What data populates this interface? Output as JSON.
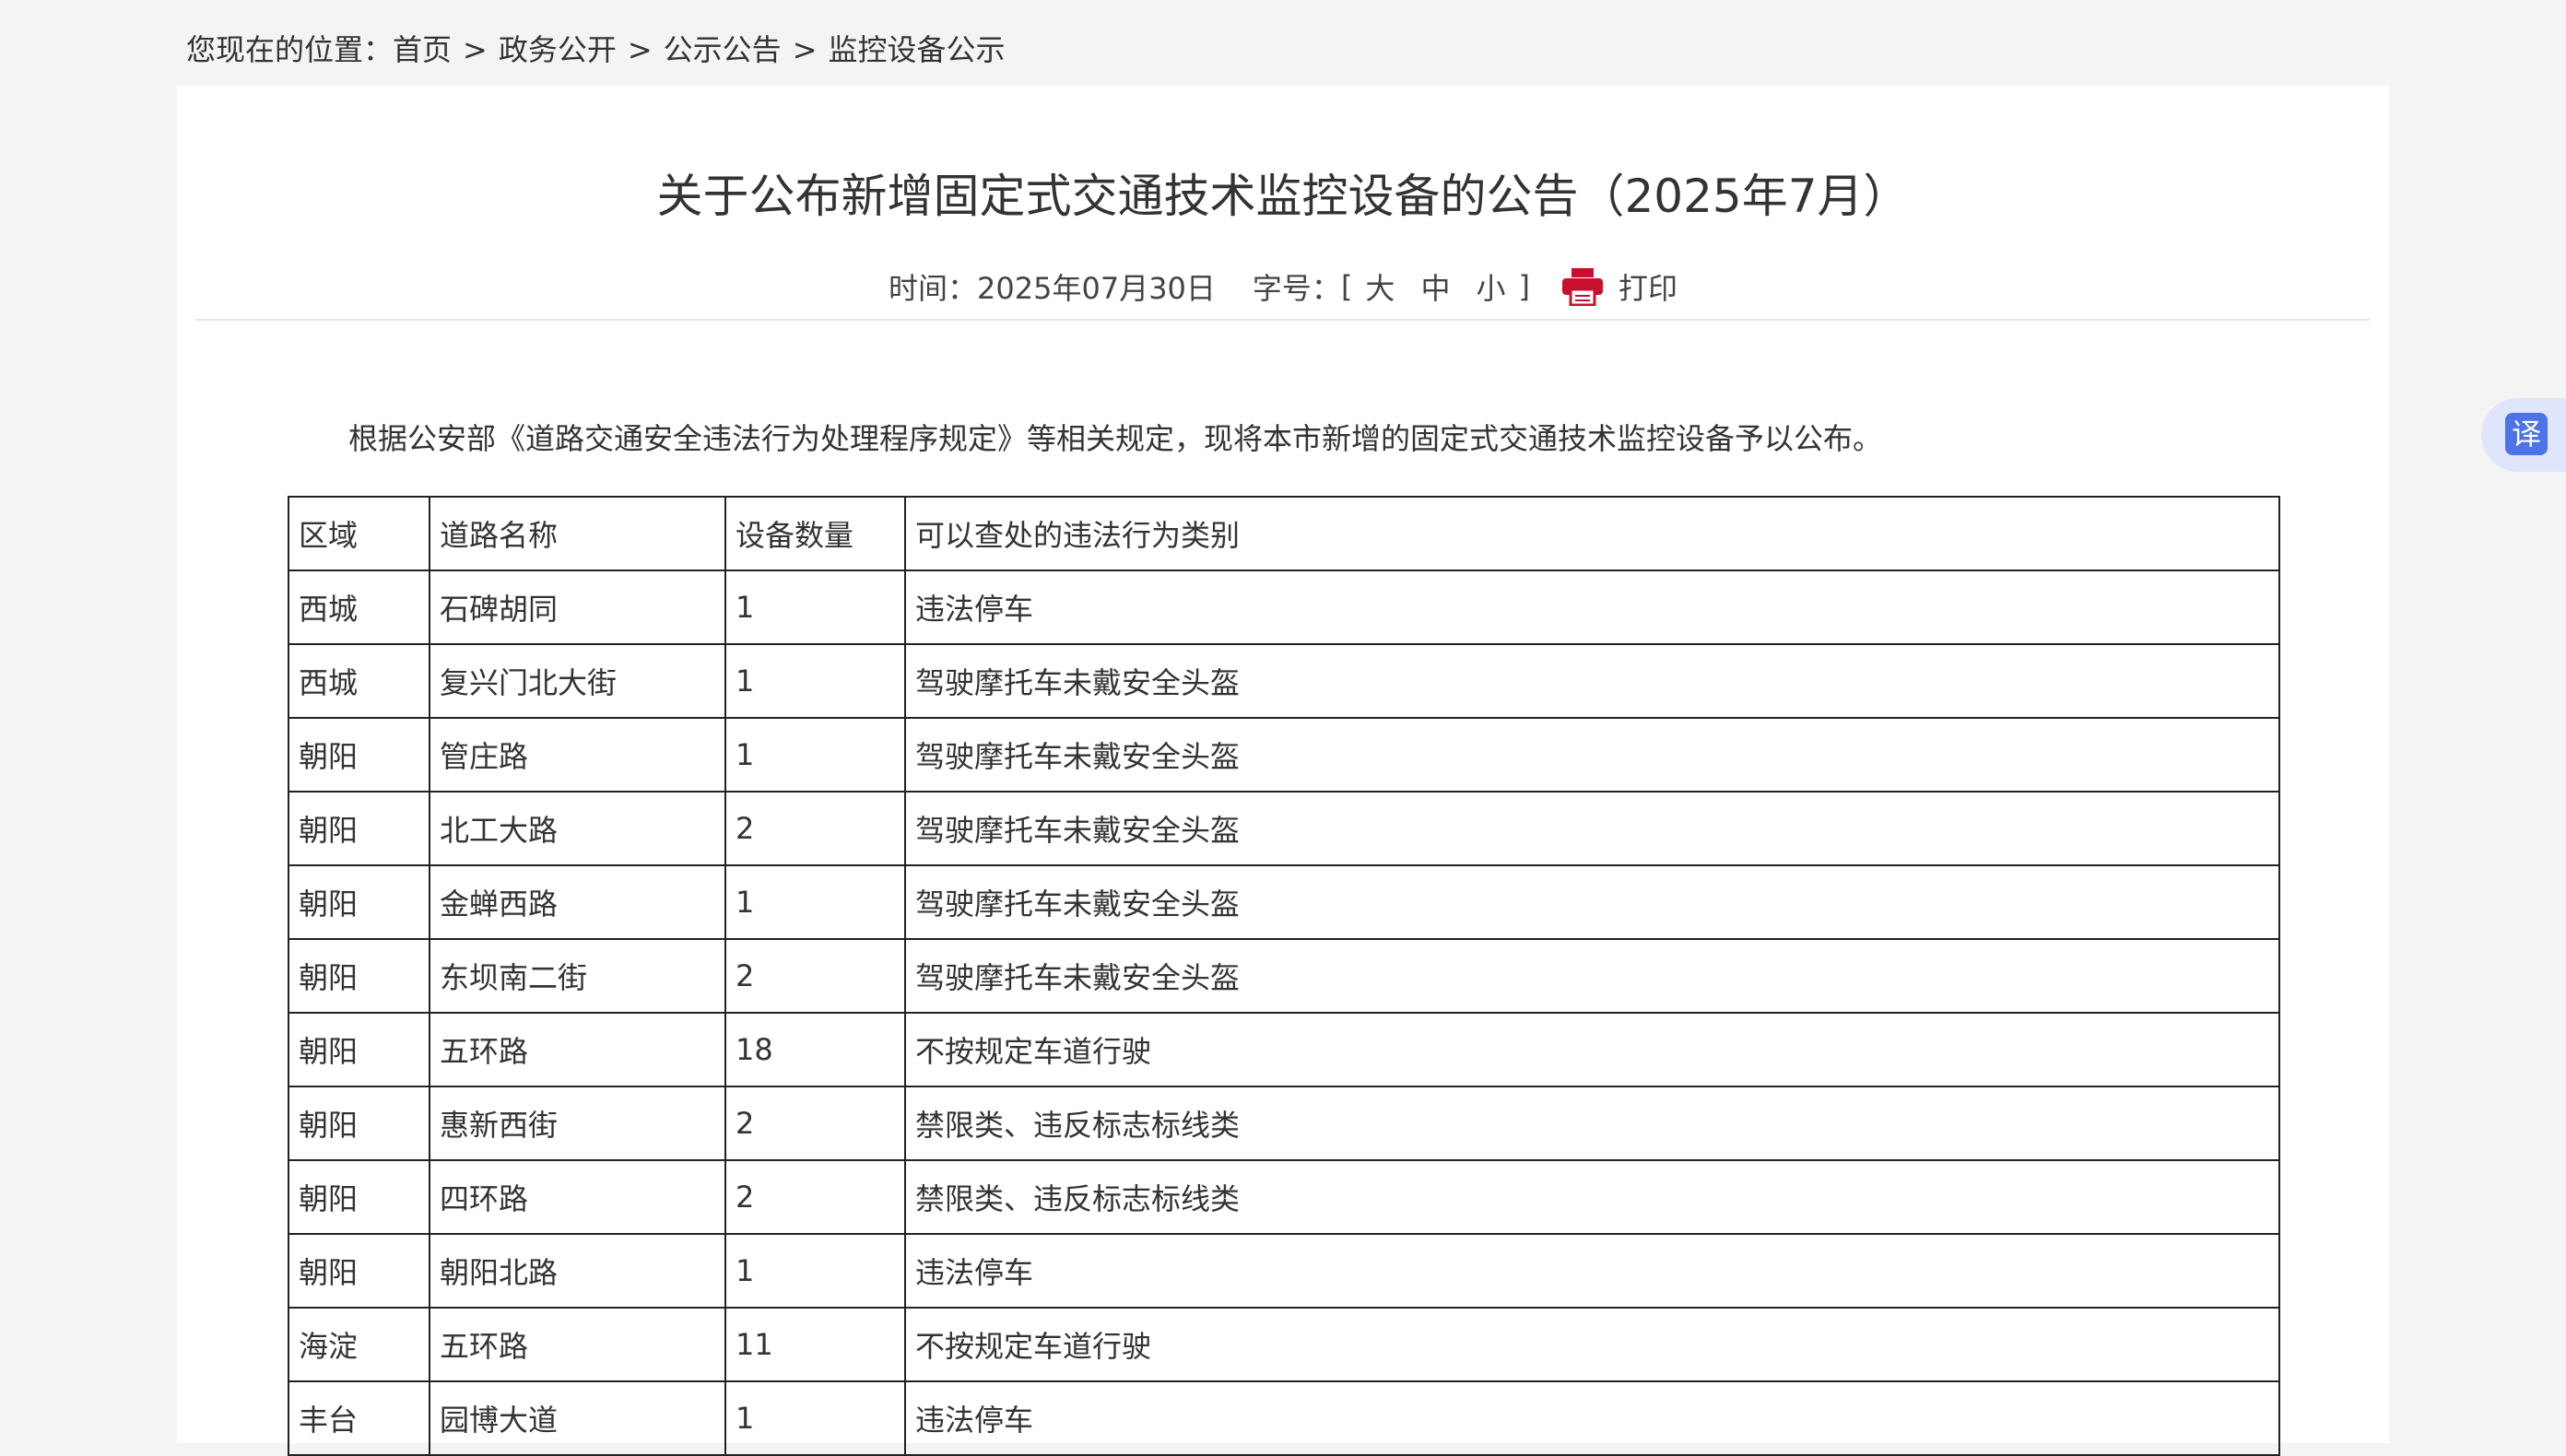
{
  "breadcrumb": {
    "prefix": "您现在的位置：",
    "items": [
      "首页",
      "政务公开",
      "公示公告",
      "监控设备公示"
    ],
    "separator": ">"
  },
  "article": {
    "title": "关于公布新增固定式交通技术监控设备的公告（2025年7月）",
    "time_label": "时间：",
    "time_value": "2025年07月30日",
    "font_size_label": "字号：",
    "bracket_open": "[",
    "bracket_close": "]",
    "font_sizes": [
      "大",
      "中",
      "小"
    ],
    "print_label": "打印",
    "intro": "根据公安部《道路交通安全违法行为处理程序规定》等相关规定，现将本市新增的固定式交通技术监控设备予以公布。"
  },
  "table": {
    "headers": [
      "区域",
      "道路名称",
      "设备数量",
      "可以查处的违法行为类别"
    ],
    "rows": [
      [
        "西城",
        "石碑胡同",
        "1",
        "违法停车"
      ],
      [
        "西城",
        "复兴门北大街",
        "1",
        "驾驶摩托车未戴安全头盔"
      ],
      [
        "朝阳",
        "管庄路",
        "1",
        "驾驶摩托车未戴安全头盔"
      ],
      [
        "朝阳",
        "北工大路",
        "2",
        "驾驶摩托车未戴安全头盔"
      ],
      [
        "朝阳",
        "金蝉西路",
        "1",
        "驾驶摩托车未戴安全头盔"
      ],
      [
        "朝阳",
        "东坝南二街",
        "2",
        "驾驶摩托车未戴安全头盔"
      ],
      [
        "朝阳",
        "五环路",
        "18",
        "不按规定车道行驶"
      ],
      [
        "朝阳",
        "惠新西街",
        "2",
        "禁限类、违反标志标线类"
      ],
      [
        "朝阳",
        "四环路",
        "2",
        "禁限类、违反标志标线类"
      ],
      [
        "朝阳",
        "朝阳北路",
        "1",
        "违法停车"
      ],
      [
        "海淀",
        "五环路",
        "11",
        "不按规定车道行驶"
      ],
      [
        "丰台",
        "园博大道",
        "1",
        "违法停车"
      ]
    ]
  },
  "translate": {
    "label": "译"
  },
  "icons": {
    "print": "printer-icon"
  },
  "colors": {
    "print_icon": "#c8102e",
    "translate_accent": "#4d74e6"
  }
}
